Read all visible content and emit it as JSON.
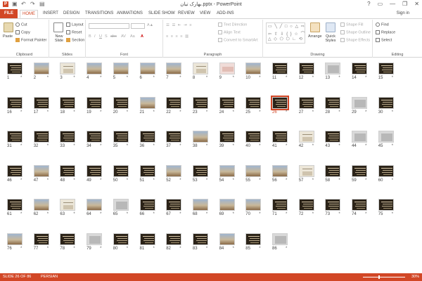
{
  "window": {
    "title": "بهارک تیان.pptx - PowerPoint",
    "controls": [
      "?",
      "▭",
      "—",
      "❐",
      "✕"
    ]
  },
  "tabs": [
    {
      "label": "FILE"
    },
    {
      "label": "HOME"
    },
    {
      "label": "INSERT"
    },
    {
      "label": "DESIGN"
    },
    {
      "label": "TRANSITIONS"
    },
    {
      "label": "ANIMATIONS"
    },
    {
      "label": "SLIDE SHOW"
    },
    {
      "label": "REVIEW"
    },
    {
      "label": "VIEW"
    },
    {
      "label": "ADD-INS"
    }
  ],
  "signin": "Sign in",
  "ribbon": {
    "clipboard": {
      "paste": "Paste",
      "cut": "Cut",
      "copy": "Copy",
      "format_painter": "Format Painter",
      "label": "Clipboard"
    },
    "slides": {
      "new_slide": "New Slide",
      "layout": "Layout",
      "reset": "Reset",
      "section": "Section",
      "label": "Slides"
    },
    "font": {
      "label": "Font",
      "buttons": [
        "B",
        "I",
        "U",
        "S",
        "abc",
        "AV",
        "Aa",
        "A"
      ]
    },
    "paragraph": {
      "text_direction": "Text Direction",
      "align_text": "Align Text",
      "convert": "Convert to SmartArt",
      "label": "Paragraph"
    },
    "drawing": {
      "arrange": "Arrange",
      "quick_styles": "Quick Styles",
      "shape_fill": "Shape Fill",
      "shape_outline": "Shape Outline",
      "shape_effects": "Shape Effects",
      "label": "Drawing"
    },
    "editing": {
      "find": "Find",
      "replace": "Replace",
      "select": "Select",
      "label": "Editing"
    }
  },
  "slides": [
    {
      "num": "1",
      "style": "dark"
    },
    {
      "num": "2",
      "style": "photo"
    },
    {
      "num": "3",
      "style": "light"
    },
    {
      "num": "4",
      "style": "photo"
    },
    {
      "num": "5",
      "style": "photo"
    },
    {
      "num": "6",
      "style": "photo"
    },
    {
      "num": "7",
      "style": "photo"
    },
    {
      "num": "8",
      "style": "light"
    },
    {
      "num": "9",
      "style": "pink"
    },
    {
      "num": "10",
      "style": "photo"
    },
    {
      "num": "11",
      "style": "dark"
    },
    {
      "num": "12",
      "style": "dark"
    },
    {
      "num": "13",
      "style": "gray"
    },
    {
      "num": "14",
      "style": "dark"
    },
    {
      "num": "15",
      "style": "dark"
    },
    {
      "num": "16",
      "style": "dark"
    },
    {
      "num": "17",
      "style": "dark"
    },
    {
      "num": "18",
      "style": "dark"
    },
    {
      "num": "19",
      "style": "dark"
    },
    {
      "num": "20",
      "style": "dark"
    },
    {
      "num": "21",
      "style": "photo"
    },
    {
      "num": "22",
      "style": "dark"
    },
    {
      "num": "23",
      "style": "dark"
    },
    {
      "num": "24",
      "style": "dark"
    },
    {
      "num": "25",
      "style": "dark"
    },
    {
      "num": "26",
      "style": "dark"
    },
    {
      "num": "27",
      "style": "dark"
    },
    {
      "num": "28",
      "style": "dark"
    },
    {
      "num": "29",
      "style": "gray"
    },
    {
      "num": "30",
      "style": "dark"
    },
    {
      "num": "31",
      "style": "dark"
    },
    {
      "num": "32",
      "style": "dark"
    },
    {
      "num": "33",
      "style": "dark"
    },
    {
      "num": "34",
      "style": "dark"
    },
    {
      "num": "35",
      "style": "dark"
    },
    {
      "num": "36",
      "style": "dark"
    },
    {
      "num": "37",
      "style": "dark"
    },
    {
      "num": "38",
      "style": "photo"
    },
    {
      "num": "39",
      "style": "dark"
    },
    {
      "num": "40",
      "style": "dark"
    },
    {
      "num": "41",
      "style": "dark"
    },
    {
      "num": "42",
      "style": "light"
    },
    {
      "num": "43",
      "style": "dark"
    },
    {
      "num": "44",
      "style": "gray"
    },
    {
      "num": "45",
      "style": "gray"
    },
    {
      "num": "46",
      "style": "dark"
    },
    {
      "num": "47",
      "style": "photo"
    },
    {
      "num": "48",
      "style": "dark"
    },
    {
      "num": "49",
      "style": "dark"
    },
    {
      "num": "50",
      "style": "dark"
    },
    {
      "num": "51",
      "style": "dark"
    },
    {
      "num": "52",
      "style": "photo"
    },
    {
      "num": "53",
      "style": "dark"
    },
    {
      "num": "54",
      "style": "photo"
    },
    {
      "num": "55",
      "style": "photo"
    },
    {
      "num": "56",
      "style": "photo"
    },
    {
      "num": "57",
      "style": "light"
    },
    {
      "num": "58",
      "style": "dark"
    },
    {
      "num": "59",
      "style": "dark"
    },
    {
      "num": "60",
      "style": "dark"
    },
    {
      "num": "61",
      "style": "dark"
    },
    {
      "num": "62",
      "style": "photo"
    },
    {
      "num": "63",
      "style": "light"
    },
    {
      "num": "64",
      "style": "photo"
    },
    {
      "num": "65",
      "style": "gray"
    },
    {
      "num": "66",
      "style": "dark"
    },
    {
      "num": "67",
      "style": "dark"
    },
    {
      "num": "68",
      "style": "photo"
    },
    {
      "num": "69",
      "style": "photo"
    },
    {
      "num": "70",
      "style": "photo"
    },
    {
      "num": "71",
      "style": "dark"
    },
    {
      "num": "72",
      "style": "dark"
    },
    {
      "num": "73",
      "style": "dark"
    },
    {
      "num": "74",
      "style": "dark"
    },
    {
      "num": "75",
      "style": "dark"
    },
    {
      "num": "76",
      "style": "photo"
    },
    {
      "num": "77",
      "style": "dark"
    },
    {
      "num": "78",
      "style": "dark"
    },
    {
      "num": "79",
      "style": "gray"
    },
    {
      "num": "80",
      "style": "dark"
    },
    {
      "num": "81",
      "style": "dark"
    },
    {
      "num": "82",
      "style": "dark"
    },
    {
      "num": "83",
      "style": "dark"
    },
    {
      "num": "84",
      "style": "photo"
    },
    {
      "num": "85",
      "style": "dark"
    },
    {
      "num": "86",
      "style": "gray"
    }
  ],
  "selected_slide": "26",
  "status": {
    "slide_info": "SLIDE 26 OF 86",
    "language": "PERSIAN",
    "zoom": "30%"
  },
  "colors": {
    "accent": "#d24726"
  }
}
